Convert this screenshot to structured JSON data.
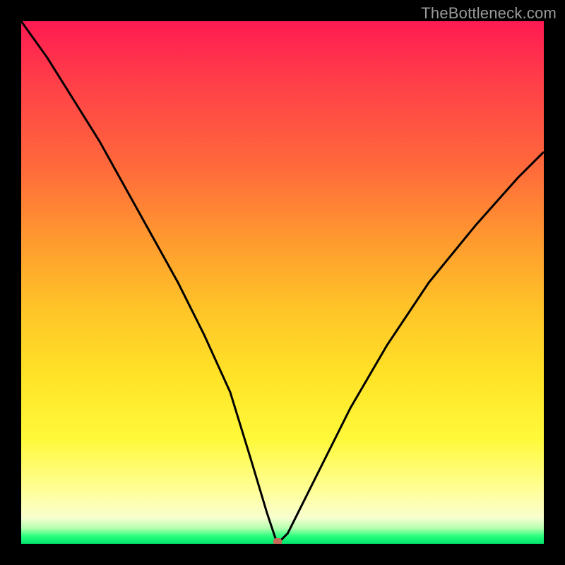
{
  "watermark": "TheBottleneck.com",
  "marker": {
    "color": "#c76a5a",
    "x_pct": 49,
    "y_pct": 100
  },
  "chart_data": {
    "type": "line",
    "title": "",
    "xlabel": "",
    "ylabel": "",
    "xlim": [
      0,
      100
    ],
    "ylim": [
      0,
      100
    ],
    "grid": false,
    "legend": false,
    "series": [
      {
        "name": "bottleneck-curve",
        "x": [
          0,
          5,
          10,
          15,
          20,
          25,
          30,
          35,
          40,
          44,
          47,
          49,
          51,
          54,
          58,
          63,
          70,
          78,
          87,
          95,
          100
        ],
        "y": [
          100,
          93,
          85,
          77,
          68,
          59,
          50,
          40,
          29,
          16,
          6,
          0,
          2,
          8,
          16,
          26,
          38,
          50,
          61,
          70,
          75
        ]
      }
    ],
    "annotations": [
      {
        "type": "marker",
        "x": 49,
        "y": 0,
        "color": "#c76a5a",
        "shape": "rounded-rect"
      }
    ],
    "background_gradient_stops": [
      {
        "pos": 0,
        "color": "#ff1a52"
      },
      {
        "pos": 0.1,
        "color": "#ff3a4a"
      },
      {
        "pos": 0.28,
        "color": "#ff6a3b"
      },
      {
        "pos": 0.42,
        "color": "#ff9a2f"
      },
      {
        "pos": 0.55,
        "color": "#ffc428"
      },
      {
        "pos": 0.68,
        "color": "#ffe327"
      },
      {
        "pos": 0.8,
        "color": "#fff93a"
      },
      {
        "pos": 0.9,
        "color": "#ffff9a"
      },
      {
        "pos": 0.95,
        "color": "#f8ffcf"
      },
      {
        "pos": 0.97,
        "color": "#b6ffb0"
      },
      {
        "pos": 0.985,
        "color": "#2cff7e"
      },
      {
        "pos": 1.0,
        "color": "#00e36b"
      }
    ]
  }
}
